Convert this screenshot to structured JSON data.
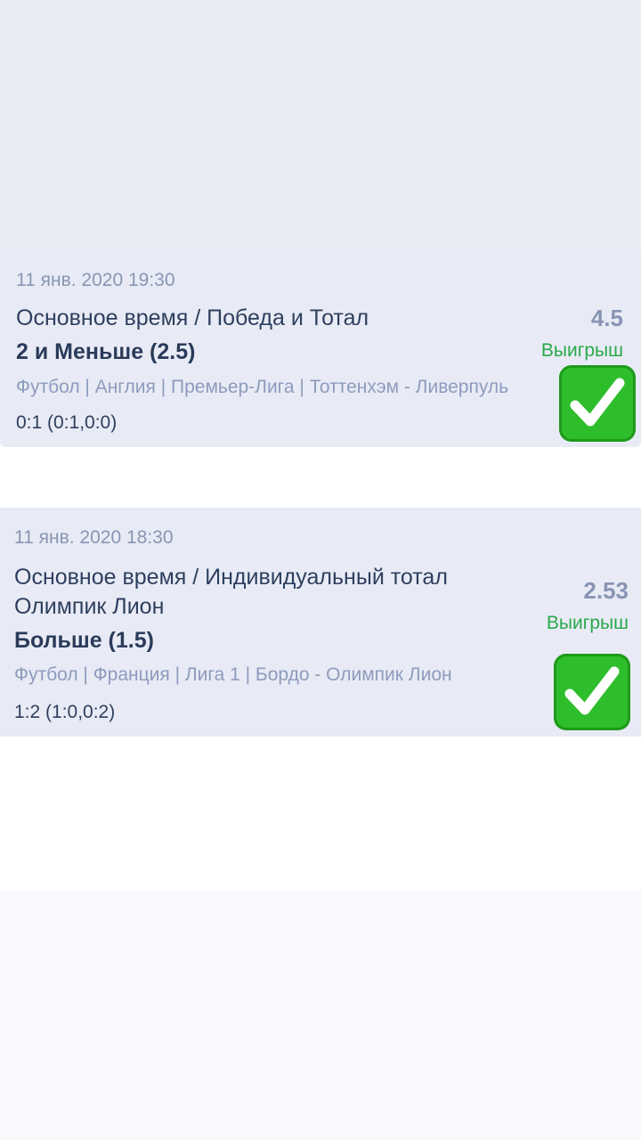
{
  "bets": [
    {
      "date": "11 янв. 2020 19:30",
      "market": "Основное время / Победа и Тотал",
      "selection": "2 и Меньше (2.5)",
      "path": "Футбол | Англия | Премьер-Лига | Тоттенхэм - Ливерпуль",
      "score": "0:1 (0:1,0:0)",
      "odds": "4.5",
      "result": "Выигрыш",
      "icon": "check-mark-button-icon"
    },
    {
      "date": "11 янв. 2020 18:30",
      "market_line1": "Основное время / Индивидуальный тотал",
      "market_line2": "Олимпик Лион",
      "selection": "Больше (1.5)",
      "path": "Футбол | Франция | Лига 1 | Бордо - Олимпик Лион",
      "score": "1:2 (1:0,0:2)",
      "odds": "2.53",
      "result": "Выигрыш",
      "icon": "check-mark-button-icon"
    }
  ],
  "colors": {
    "win_green": "#2aa84a",
    "check_green": "#2fbe2b",
    "card_bg": "#e8ebf5"
  }
}
